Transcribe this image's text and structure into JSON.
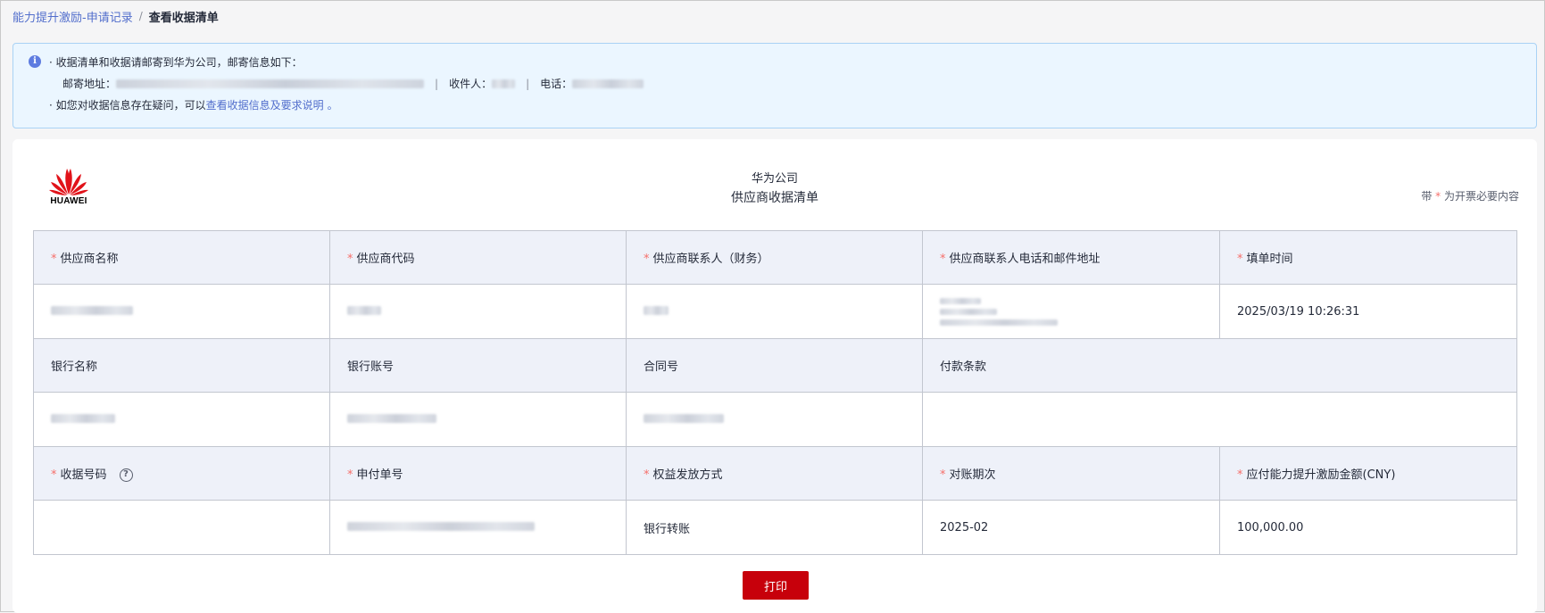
{
  "breadcrumb": {
    "parent": "能力提升激励-申请记录",
    "separator": "/",
    "current": "查看收据清单"
  },
  "notice": {
    "icon": "info-icon",
    "line1": "· 收据清单和收据请邮寄到华为公司，邮寄信息如下：",
    "address_label": "邮寄地址：",
    "recipient_label": "收件人：",
    "phone_label": "电话：",
    "separator": "|",
    "line3_prefix": "· 如您对收据信息存在疑问，可以",
    "line3_link": "查看收据信息及要求说明",
    "line3_suffix": "。"
  },
  "document": {
    "logo_text": "HUAWEI",
    "company": "华为公司",
    "title": "供应商收据清单",
    "required_note_prefix": "带",
    "required_note_star": "*",
    "required_note_suffix": "为开票必要内容"
  },
  "table": {
    "row1_headers": [
      "供应商名称",
      "供应商代码",
      "供应商联系人（财务）",
      "供应商联系人电话和邮件地址",
      "填单时间"
    ],
    "row1_values": {
      "fill_time": "2025/03/19 10:26:31"
    },
    "row2_headers": [
      "银行名称",
      "银行账号",
      "合同号",
      "付款条款"
    ],
    "row3_headers": [
      "收据号码",
      "申付单号",
      "权益发放方式",
      "对账期次",
      "应付能力提升激励金额(CNY)"
    ],
    "row3_values": {
      "payment_method": "银行转账",
      "period": "2025-02",
      "amount": "100,000.00"
    },
    "required_star": "*",
    "help_icon": "?"
  },
  "actions": {
    "print_label": "打印"
  },
  "colors": {
    "brand_red": "#c7000b",
    "link_blue": "#526ecc",
    "notice_bg": "#ebf6ff",
    "header_bg": "#eef1f9",
    "required_star": "#f66f6a"
  }
}
